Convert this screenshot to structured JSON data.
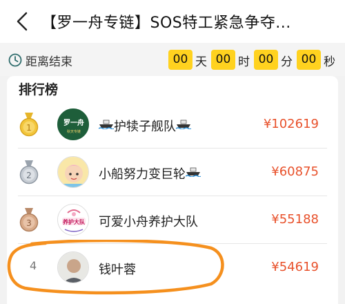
{
  "header": {
    "title": "【罗一舟专链】SOS特工紧急争夺..."
  },
  "countdown": {
    "label": "距离结束",
    "days": "00",
    "days_unit": "天",
    "hours": "00",
    "hours_unit": "时",
    "minutes": "00",
    "minutes_unit": "分",
    "seconds": "00",
    "seconds_unit": "秒"
  },
  "leaderboard": {
    "title": "排行榜",
    "rows": [
      {
        "rank": "1",
        "name": "护犊子舰队",
        "amount": "¥102619",
        "avatar_text": "罗一舟",
        "avatar_subtext": "秋天专链",
        "medal": "gold-medal-icon"
      },
      {
        "rank": "2",
        "name": "小船努力变巨轮",
        "amount": "¥60875",
        "medal": "silver-medal-icon"
      },
      {
        "rank": "3",
        "name": "可爱小舟养护大队",
        "amount": "¥55188",
        "avatar_text": "养护大队",
        "medal": "bronze-medal-icon"
      },
      {
        "rank": "4",
        "name": "钱叶蓉",
        "amount": "¥54619"
      }
    ]
  },
  "colors": {
    "accent_yellow": "#ffd21f",
    "amount_red": "#e8512b",
    "highlight_orange": "#f5901e"
  }
}
